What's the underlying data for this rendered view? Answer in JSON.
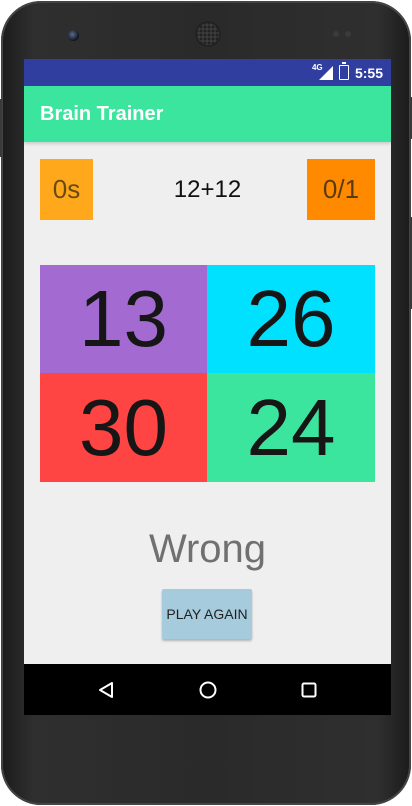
{
  "status_bar": {
    "network": "4G",
    "time": "5:55"
  },
  "app": {
    "title": "Brain Trainer",
    "accent_color": "#3ce59d",
    "status_bar_color": "#303f9f"
  },
  "game": {
    "timer": "0s",
    "question": "12+12",
    "score": "0/1",
    "answers": [
      "13",
      "26",
      "30",
      "24"
    ],
    "result": "Wrong",
    "play_again_label": "PLAY AGAIN"
  },
  "nav": {
    "back_icon": "back-icon",
    "home_icon": "home-icon",
    "recents_icon": "recents-icon"
  }
}
